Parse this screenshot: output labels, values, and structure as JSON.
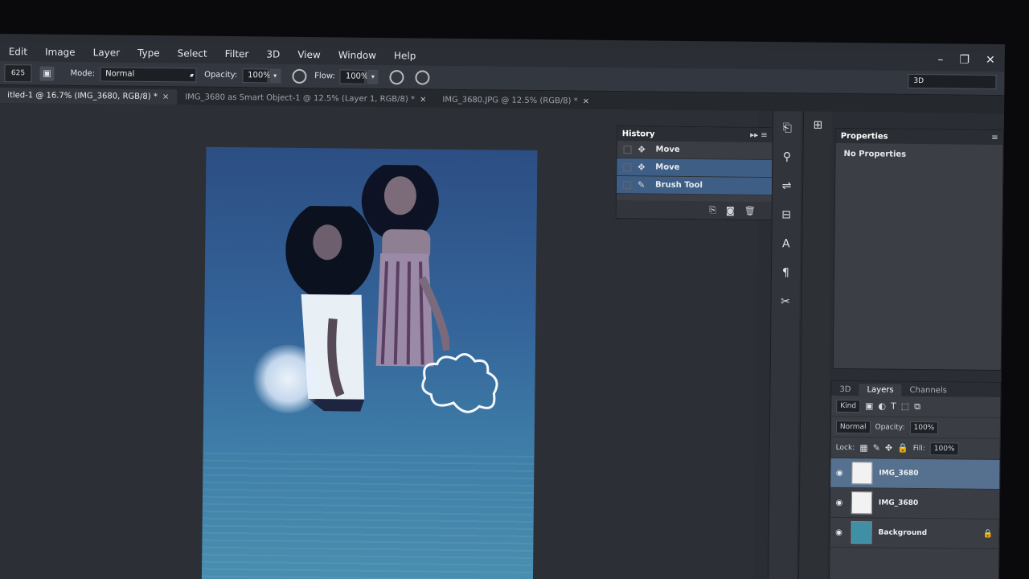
{
  "menu": [
    "Edit",
    "Image",
    "Layer",
    "Type",
    "Select",
    "Filter",
    "3D",
    "View",
    "Window",
    "Help"
  ],
  "window_controls": [
    "–",
    "❐",
    "✕"
  ],
  "options": {
    "tool_preset": "625",
    "mode_label": "Mode:",
    "mode_value": "Normal",
    "opacity_label": "Opacity:",
    "opacity_value": "100%",
    "flow_label": "Flow:",
    "flow_value": "100%",
    "workspace_value": "3D"
  },
  "tabs": [
    {
      "label": "itled-1 @ 16.7% (IMG_3680, RGB/8) *",
      "active": true
    },
    {
      "label": "IMG_3680 as Smart Object-1 @ 12.5% (Layer 1, RGB/8) *",
      "active": false
    },
    {
      "label": "IMG_3680.JPG @ 12.5% (RGB/8) *",
      "active": false
    }
  ],
  "tab_close": "×",
  "history": {
    "title": "History",
    "rows": [
      {
        "label": "Move",
        "icon": "move-icon",
        "selected": false
      },
      {
        "label": "Move",
        "icon": "move-icon",
        "selected": true
      },
      {
        "label": "Brush Tool",
        "icon": "brush-icon",
        "selected": true
      }
    ]
  },
  "properties": {
    "title": "Properties",
    "body": "No Properties"
  },
  "layers_panel": {
    "tabs": [
      "3D",
      "Layers",
      "Channels"
    ],
    "active_tab": "Layers",
    "filter": "Kind",
    "blend": "Normal",
    "opacity_label": "Opacity:",
    "opacity_value": "100%",
    "lock_label": "Lock:",
    "fill_label": "Fill:",
    "fill_value": "100%",
    "layers": [
      {
        "name": "IMG_3680",
        "selected": true,
        "background": false
      },
      {
        "name": "IMG_3680",
        "selected": false,
        "background": false
      },
      {
        "name": "Background",
        "selected": false,
        "background": true
      }
    ]
  },
  "colors": {
    "selection": "#3f5e86",
    "layer_selected": "#55718f",
    "canvas_top": "#2c4e83",
    "canvas_bottom": "#4a8fb0"
  }
}
